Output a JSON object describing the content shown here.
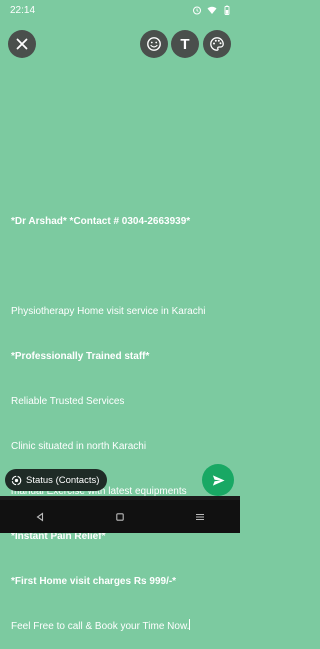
{
  "status_bar": {
    "time": "22:14",
    "icons": [
      "alarm-icon",
      "wifi-icon",
      "battery-icon"
    ]
  },
  "toolbar": {
    "close_icon": "close-icon",
    "emoji_icon": "emoji-icon",
    "text_label": "T",
    "palette_icon": "palette-icon"
  },
  "status_text": {
    "line1_name": "*Dr Arshad*",
    "line1_contact": "*Contact # 0304-2663939*",
    "line2": "Physiotherapy Home visit service in Karachi",
    "line3": "*Professionally Trained staff*",
    "line4": "Reliable Trusted Services",
    "line5": "Clinic situated in north Karachi",
    "line6": "manual Exercise with latest equipments",
    "line7": "*Instant Pain Relief*",
    "line8": "*First Home visit charges Rs 999/-*",
    "line9": "Feel Free to call & Book your Time Now."
  },
  "audience": {
    "label": "Status (Contacts)"
  },
  "send": {
    "icon": "send-icon"
  },
  "nav": {
    "icons": [
      "back-icon",
      "home-icon",
      "recents-icon"
    ]
  },
  "colors": {
    "background": "#7ccaa0",
    "chip": "#1f2b26",
    "send": "#19a864",
    "button": "#4a4f4c"
  }
}
